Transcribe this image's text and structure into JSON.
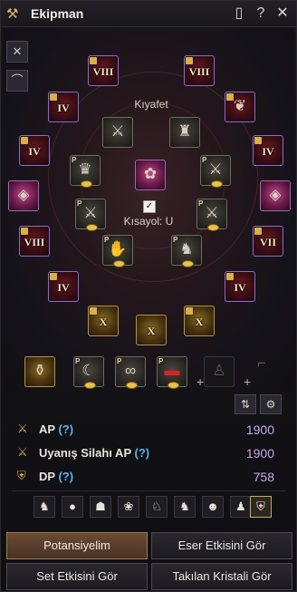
{
  "window": {
    "title": "Ekipman",
    "icon": "armor-hanger-icon"
  },
  "titlebar_buttons": [
    {
      "name": "page-icon",
      "glyph": "🗎"
    },
    {
      "name": "help-icon",
      "glyph": "?"
    },
    {
      "name": "close-icon",
      "glyph": "✕"
    }
  ],
  "equipment": {
    "costume_label": "Kıyafet",
    "shortcut_label": "Kısayol: U",
    "shortcut_checked": true,
    "grades": [
      "VIII",
      "VIII",
      "IV",
      "IV",
      "IV",
      "VIII",
      "VII",
      "IV",
      "IV",
      "X",
      "X",
      "X"
    ]
  },
  "stats": {
    "ap": {
      "label": "AP",
      "q": "(?)",
      "value": "1900"
    },
    "awaken_ap": {
      "label": "Uyanış Silahı AP",
      "q": "(?)",
      "value": "1900"
    },
    "dp": {
      "label": "DP",
      "q": "(?)",
      "value": "758"
    }
  },
  "buttons": {
    "potential": "Potansiyelim",
    "artifact": "Eser Etkisini Gör",
    "set": "Set Etkisini Gör",
    "crystal": "Takılan Kristali Gör"
  },
  "colors": {
    "accent": "#c9a661",
    "stat_value": "#c8a6f0",
    "help": "#5ab4f0"
  }
}
